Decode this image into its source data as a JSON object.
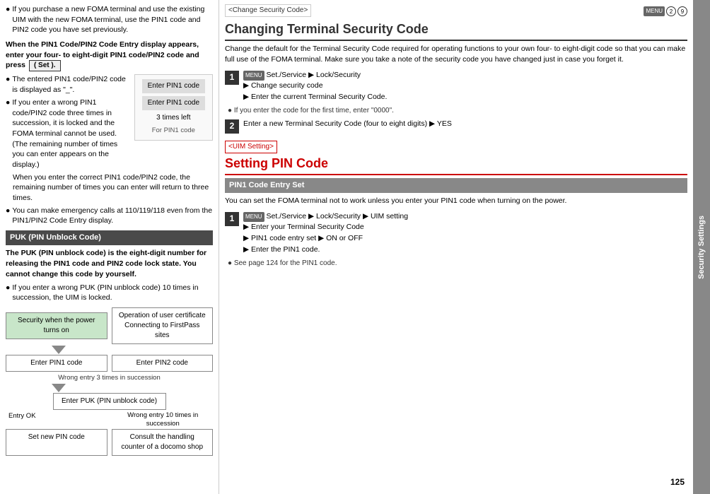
{
  "left": {
    "bullet1": "If you purchase a new FOMA terminal and use the existing UIM with the new FOMA terminal, use the PIN1 code and PIN2 code you have set previously.",
    "bold_intro": "When the PIN1 Code/PIN2 Code Entry display appears, enter your four- to eight-digit PIN1 code/PIN2 code and press",
    "button_label": "( Set ).",
    "bullet2": "The entered PIN1 code/PIN2 code is displayed as \"_\".",
    "bullet3": "If you enter a wrong PIN1 code/PIN2 code three times in succession, it is locked and the FOMA terminal cannot be used. (The remaining number of times you can enter appears on the display.)",
    "bullet3b": "When you enter the correct PIN1 code/PIN2 code, the remaining number of times you can enter will return to three times.",
    "bullet4": "You can make emergency calls at 110/119/118 even from the PIN1/PIN2 Code Entry display.",
    "pin_display": {
      "row1": "Enter PIN1 code",
      "row2": "Enter PIN1 code",
      "count": "3 times left",
      "label": "For PIN1 code"
    },
    "puk_header": "PUK (PIN Unblock Code)",
    "puk_desc": "The PUK (PIN unblock code) is the eight-digit number for releasing the PIN1 code and PIN2 code lock state. You cannot change this code by yourself.",
    "puk_note": "If you enter a wrong PUK (PIN unblock code) 10 times in succession, the UIM is locked.",
    "flow": {
      "box1": "Security when the power turns on",
      "box2": "Operation of user certificate\nConnecting to FirstPass sites",
      "box3": "Enter PIN1 code",
      "box4": "Enter PIN2 code",
      "wrong_label": "Wrong entry 3 times in succession",
      "box5": "Enter PUK (PIN unblock code)",
      "label_ok": "Entry OK",
      "label_wrong": "Wrong entry 10 times\nin succession",
      "box6": "Set new PIN code",
      "box7": "Consult the handling\ncounter of a docomo shop"
    }
  },
  "right": {
    "section1": {
      "tag": "<Change Security Code>",
      "title": "Changing Terminal Security Code",
      "desc": "Change the default for the Terminal Security Code required for operating functions to your own four- to eight-digit code so that you can make full use of the FOMA terminal. Make sure you take a note of the security code you have changed just in case you forget it.",
      "step1": {
        "num": "1",
        "line1": "Set./Service",
        "arrow1": "▶",
        "line2": "Lock/Security",
        "arrow2": "▶",
        "line3": "Change security code",
        "arrow3": "▶",
        "line4": "Enter the current Terminal Security Code.",
        "note": "If you enter the code for the first time, enter \"0000\"."
      },
      "step2": {
        "num": "2",
        "line1": "Enter a new Terminal Security Code (four to eight digits)",
        "arrow": "▶",
        "line2": "YES"
      }
    },
    "section2": {
      "tag": "<UIM Setting>",
      "title": "Setting PIN Code",
      "subsection": "PIN1 Code Entry Set",
      "desc": "You can set the FOMA terminal not to work unless you enter your PIN1 code when turning on the power.",
      "step1": {
        "num": "1",
        "line1": "Set./Service",
        "arrow1": "▶",
        "line2": "Lock/Security",
        "arrow2": "▶",
        "line3": "UIM setting",
        "arrow3": "▶",
        "line4": "Enter your Terminal Security Code",
        "arrow4": "▶",
        "line5": "PIN1 code entry set",
        "arrow5": "▶",
        "line6": "ON or OFF",
        "arrow6": "▶",
        "line7": "Enter the PIN1 code.",
        "note": "See page 124 for the PIN1 code."
      }
    },
    "page_number": "125",
    "tab_label": "Security Settings",
    "menu_num1": "2",
    "menu_num2": "9"
  }
}
